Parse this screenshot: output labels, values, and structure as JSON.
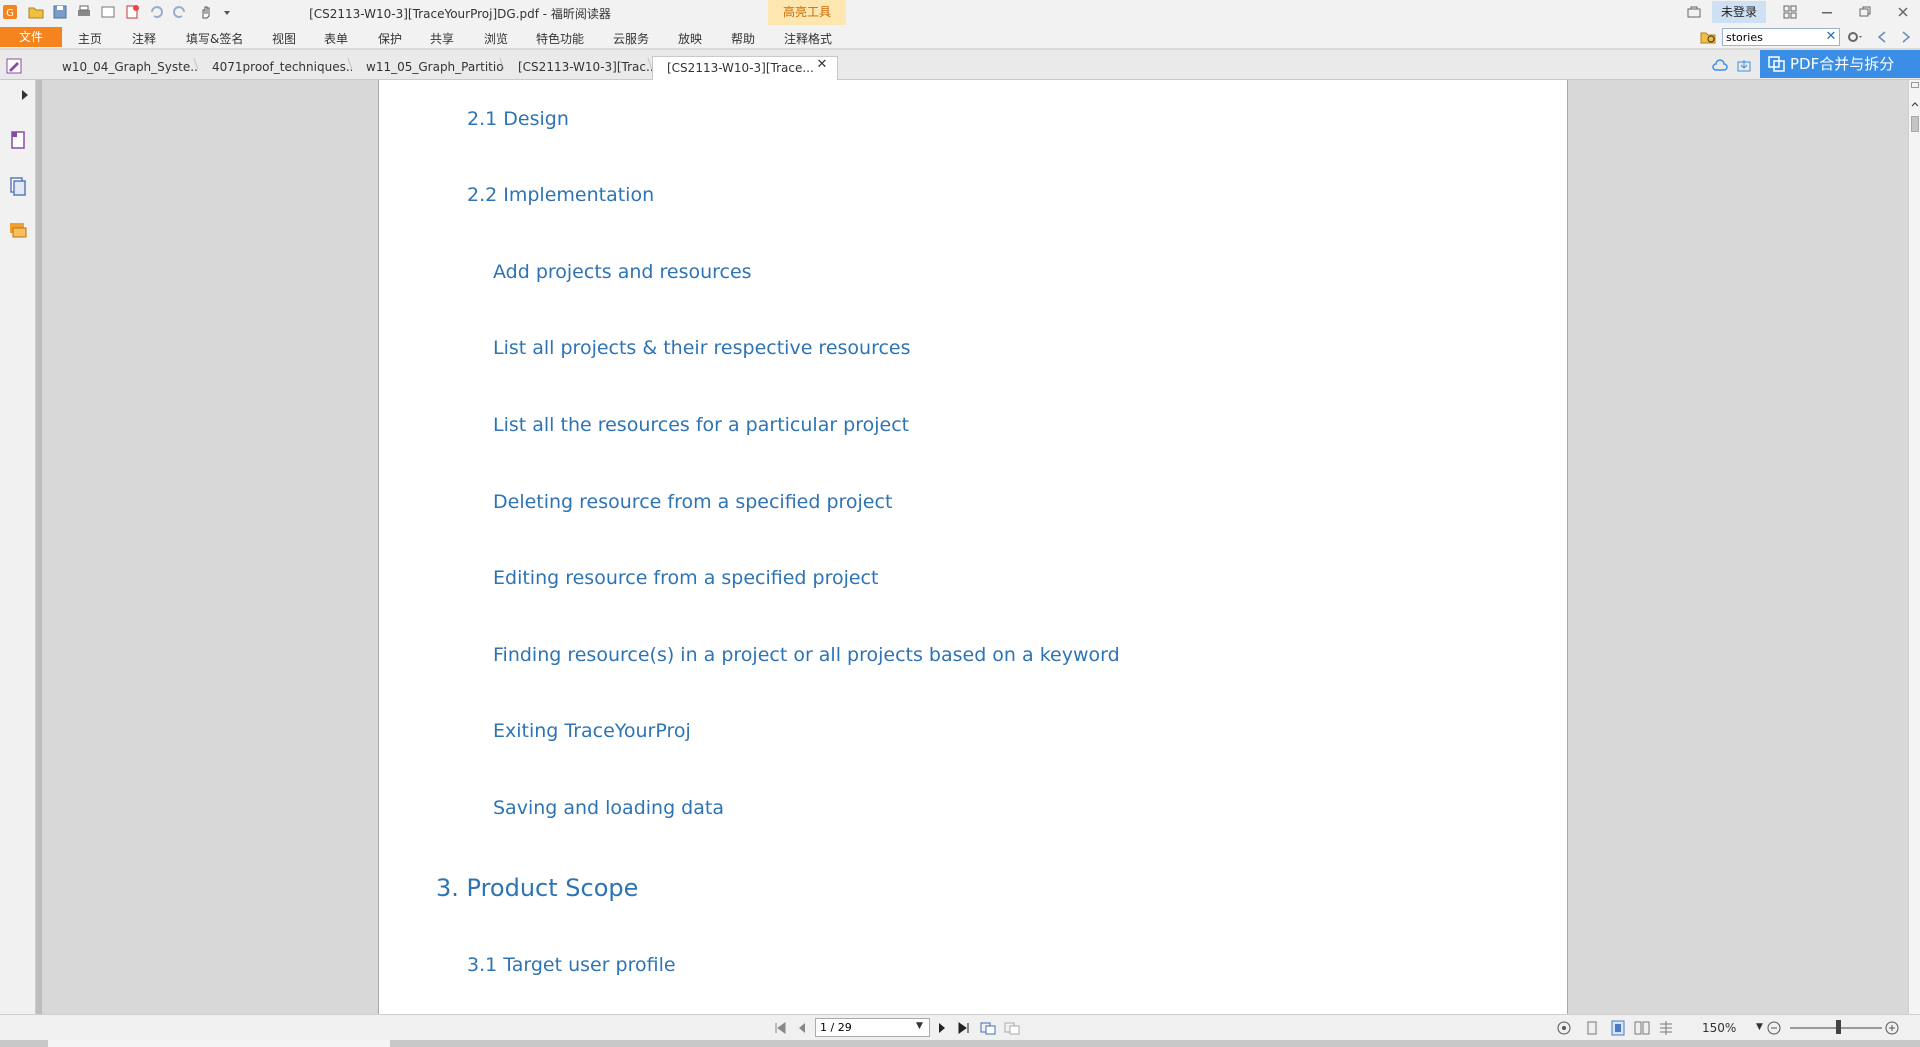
{
  "titlebar": {
    "app_title": "[CS2113-W10-3][TraceYourProj]DG.pdf - 福昕阅读器",
    "highlight_tools": "高亮工具",
    "login": "未登录"
  },
  "menu": {
    "file": "文件",
    "items": [
      "主页",
      "注释",
      "填写&签名",
      "视图",
      "表单",
      "保护",
      "共享",
      "浏览",
      "特色功能",
      "云服务",
      "放映",
      "帮助",
      "注释格式"
    ]
  },
  "search": {
    "value": "stories"
  },
  "tabs": [
    {
      "label": "w10_04_Graph_Syste..."
    },
    {
      "label": "4071proof_techniques...."
    },
    {
      "label": "w11_05_Graph_Partitio..."
    },
    {
      "label": "[CS2113-W10-3][Trac..."
    },
    {
      "label": "[CS2113-W10-3][Trace..."
    }
  ],
  "merge_button": "PDF合并与拆分",
  "document": {
    "entries": [
      {
        "text": "2.1 Design",
        "level": 2
      },
      {
        "text": "2.2 Implementation",
        "level": 2
      },
      {
        "text": "Add projects and resources",
        "level": 3
      },
      {
        "text": "List all projects & their respective resources",
        "level": 3
      },
      {
        "text": "List all the resources for a particular project",
        "level": 3
      },
      {
        "text": "Deleting resource from a specified project",
        "level": 3
      },
      {
        "text": "Editing resource from a specified project",
        "level": 3
      },
      {
        "text": "Finding resource(s) in a project or all projects based on a keyword",
        "level": 3
      },
      {
        "text": "Exiting TraceYourProj",
        "level": 3
      },
      {
        "text": "Saving and loading data",
        "level": 3
      },
      {
        "text": "3. Product Scope",
        "level": 1
      },
      {
        "text": "3.1 Target user profile",
        "level": 2
      }
    ]
  },
  "status": {
    "page": "1 / 29",
    "zoom": "150%"
  },
  "colors": {
    "accent": "#f5841f",
    "link_blue": "#2e74b5",
    "merge_blue": "#3a8ee6"
  }
}
